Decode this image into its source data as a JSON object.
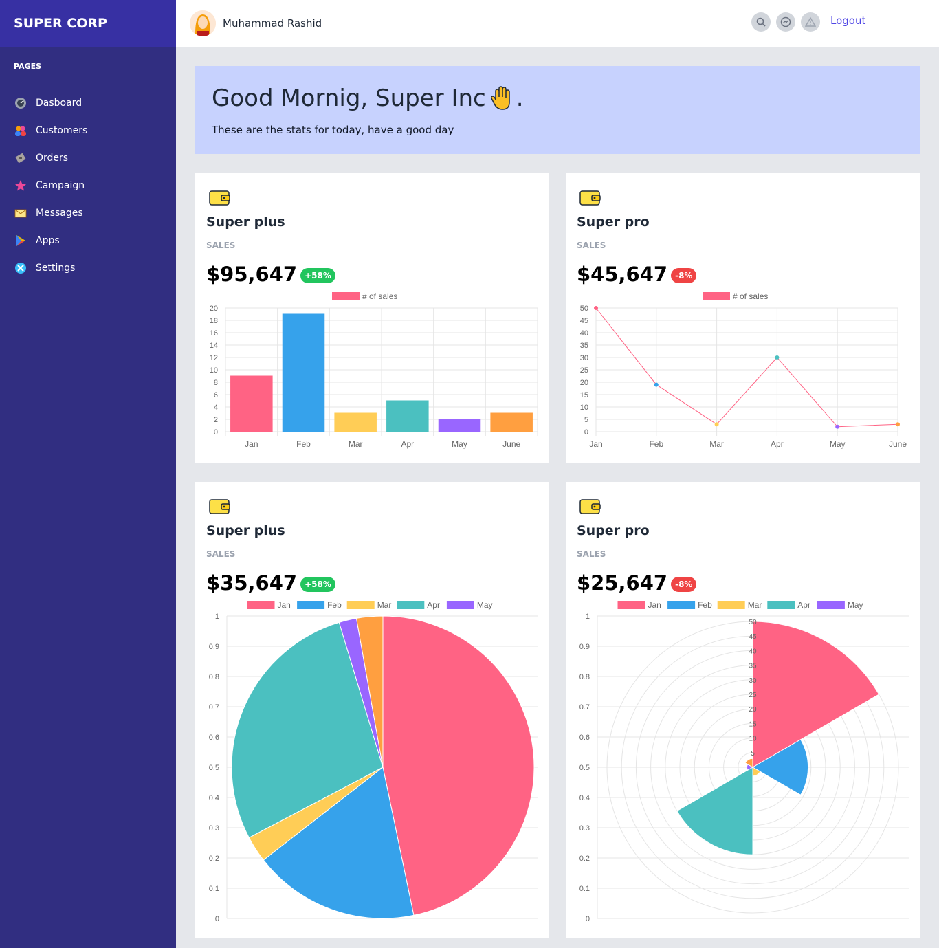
{
  "brand": "SUPER CORP",
  "sidebar": {
    "section_label": "PAGES",
    "items": [
      {
        "label": "Dasboard",
        "icon": "dashboard-icon"
      },
      {
        "label": "Customers",
        "icon": "customers-icon"
      },
      {
        "label": "Orders",
        "icon": "orders-icon"
      },
      {
        "label": "Campaign",
        "icon": "star-icon"
      },
      {
        "label": "Messages",
        "icon": "envelope-icon"
      },
      {
        "label": "Apps",
        "icon": "play-icon"
      },
      {
        "label": "Settings",
        "icon": "settings-icon"
      }
    ]
  },
  "header": {
    "username": "Muhammad Rashid",
    "icons": [
      "search-icon",
      "messenger-icon",
      "warning-icon"
    ],
    "logout_label": "Logout"
  },
  "welcome": {
    "title": "Good Mornig, Super Inc",
    "title_suffix": ".",
    "subtitle": "These are the stats for today, have a good day"
  },
  "colors": {
    "sidebar": "#312e81",
    "brand_bg": "#3730a3",
    "welcome_bg": "#c7d2fe",
    "jan": "#ff6384",
    "feb": "#36a2eb",
    "mar": "#ffcd56",
    "apr": "#4bc0c0",
    "may": "#9966ff",
    "june": "#ff9f40",
    "badge_up": "#22c55e",
    "badge_down": "#ef4444"
  },
  "cards": [
    {
      "title": "Super plus",
      "sales_label": "SALES",
      "value": "$95,647",
      "badge": "+58%",
      "trend": "up"
    },
    {
      "title": "Super pro",
      "sales_label": "SALES",
      "value": "$45,647",
      "badge": "-8%",
      "trend": "down"
    },
    {
      "title": "Super plus",
      "sales_label": "SALES",
      "value": "$35,647",
      "badge": "+58%",
      "trend": "up"
    },
    {
      "title": "Super pro",
      "sales_label": "SALES",
      "value": "$25,647",
      "badge": "-8%",
      "trend": "down"
    }
  ],
  "chart_data": [
    {
      "type": "bar",
      "legend": [
        "# of sales"
      ],
      "categories": [
        "Jan",
        "Feb",
        "Mar",
        "Apr",
        "May",
        "June"
      ],
      "values": [
        9,
        19,
        3,
        5,
        2,
        3
      ],
      "ylim": [
        0,
        20
      ],
      "yticks": [
        0,
        2,
        4,
        6,
        8,
        10,
        12,
        14,
        16,
        18,
        20
      ],
      "grid": true,
      "legend_position": "top"
    },
    {
      "type": "line",
      "legend": [
        "# of sales"
      ],
      "categories": [
        "Jan",
        "Feb",
        "Mar",
        "Apr",
        "May",
        "June"
      ],
      "values": [
        50,
        19,
        3,
        30,
        2,
        3
      ],
      "ylim": [
        0,
        50
      ],
      "yticks": [
        0,
        5,
        10,
        15,
        20,
        25,
        30,
        35,
        40,
        45,
        50
      ],
      "grid": true,
      "legend_position": "top"
    },
    {
      "type": "pie",
      "legend": [
        "Jan",
        "Feb",
        "Mar",
        "Apr",
        "May"
      ],
      "values": [
        50,
        19,
        3,
        30,
        2,
        3
      ],
      "yticks": [
        "0",
        "0.1",
        "0.2",
        "0.3",
        "0.4",
        "0.5",
        "0.6",
        "0.7",
        "0.8",
        "0.9",
        "1"
      ],
      "grid": true,
      "legend_position": "top"
    },
    {
      "type": "polar-area",
      "legend": [
        "Jan",
        "Feb",
        "Mar",
        "Apr",
        "May"
      ],
      "values": [
        50,
        19,
        3,
        30,
        2,
        3
      ],
      "yticks": [
        "0",
        "0.1",
        "0.2",
        "0.3",
        "0.4",
        "0.5",
        "0.6",
        "0.7",
        "0.8",
        "0.9",
        "1"
      ],
      "radial_max": 50,
      "grid": true,
      "legend_position": "top"
    }
  ]
}
